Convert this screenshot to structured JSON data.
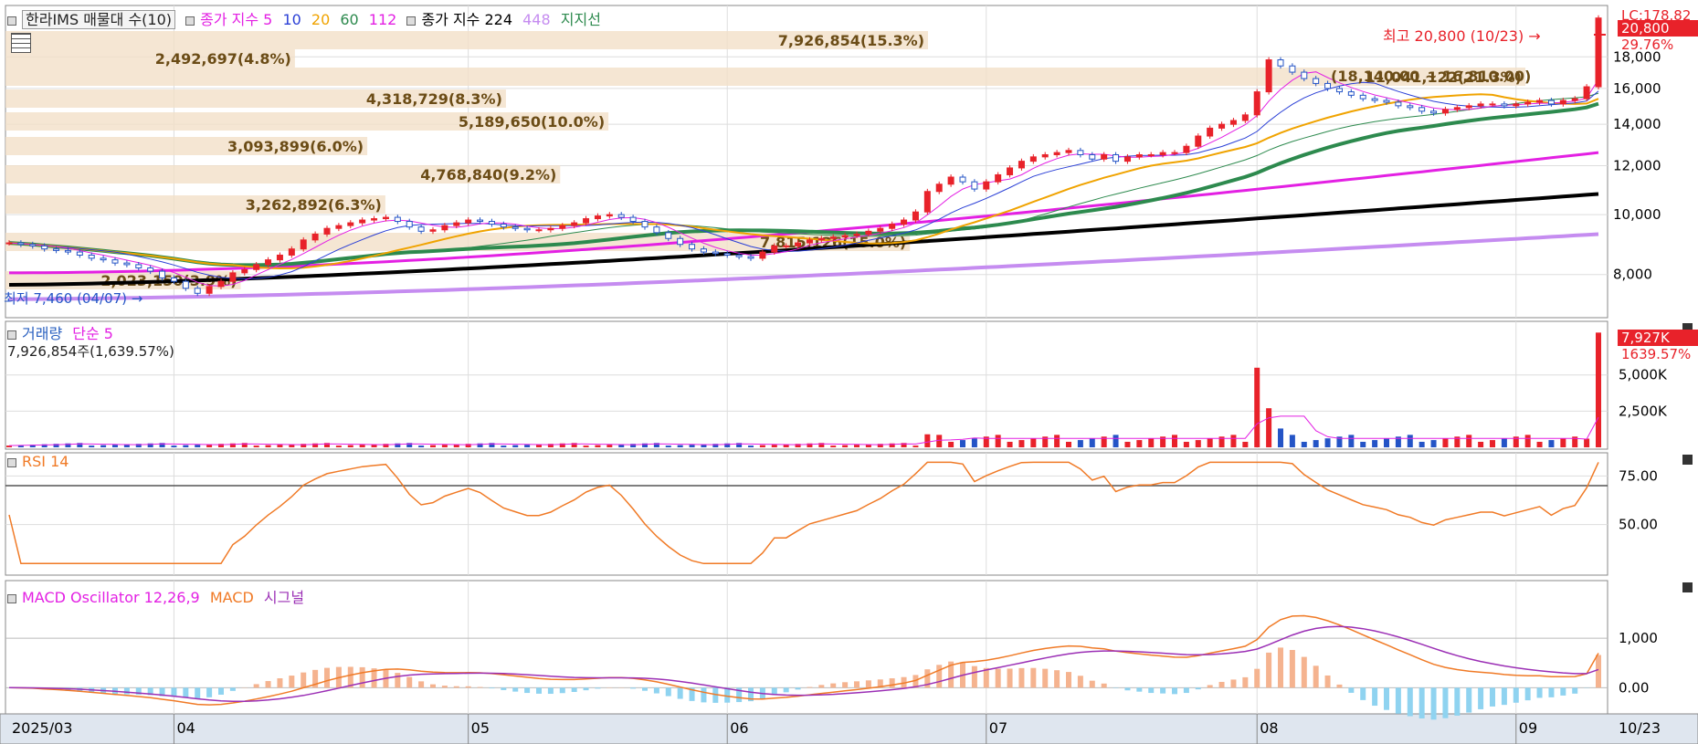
{
  "price_legend": {
    "title": "한라IMS 매물대 수(10)",
    "ma_label": "종가 지수 5",
    "ma10": "10",
    "ma20": "20",
    "ma60": "60",
    "ma112": "112",
    "ma224_label": "종가 지수 224",
    "ma448": "448",
    "support": "지지선"
  },
  "volume_legend": {
    "title": "거래량",
    "ma": "단순 5",
    "readout": "7,926,854주(1,639.57%)"
  },
  "rsi_legend": {
    "title": "RSI 14"
  },
  "macd_legend": {
    "title": "MACD Oscillator 12,26,9",
    "macd": "MACD",
    "signal": "시그널"
  },
  "annotations": {
    "high": "최고 20,800 (10/23) →",
    "low": "최저 7,460 (04/07) →",
    "lc": "LC:178.82",
    "price_tag": "20,800",
    "pct_tag": "29.76%",
    "vol_tag": "7,927K",
    "vol_pct": "1639.57%"
  },
  "colors": {
    "up": "#e8222a",
    "down": "#2454c6",
    "ma5": "#e320e3",
    "ma10": "#2a3fd6",
    "ma20": "#f0a300",
    "ma60": "#2d8a4e",
    "ma112": "#e320e3",
    "ma224": "#000000",
    "ma448": "#c58cf0",
    "rsi": "#f07a26",
    "macd": "#f07a26",
    "signal": "#9b2fb5"
  },
  "chart_data": [
    {
      "type": "candlestick",
      "title": "한라IMS 매물대 수(10)",
      "y_ticks": [
        8000,
        10000,
        12000,
        14000,
        16000,
        18000
      ],
      "x_ticks": [
        "2025/03",
        "04",
        "05",
        "06",
        "07",
        "08",
        "09",
        "10",
        "10/23"
      ],
      "last_close": 20800,
      "high": {
        "value": 20800,
        "date": "10/23"
      },
      "low": {
        "value": 7460,
        "date": "04/07"
      },
      "closes": [
        9000,
        8950,
        8900,
        8800,
        8750,
        8700,
        8600,
        8500,
        8450,
        8350,
        8300,
        8200,
        8100,
        7900,
        7800,
        7600,
        7460,
        7650,
        7800,
        8050,
        8150,
        8300,
        8450,
        8600,
        8800,
        9100,
        9300,
        9500,
        9600,
        9700,
        9800,
        9850,
        9900,
        9750,
        9550,
        9400,
        9450,
        9600,
        9700,
        9800,
        9750,
        9650,
        9550,
        9500,
        9450,
        9450,
        9500,
        9600,
        9700,
        9850,
        9950,
        10000,
        9900,
        9750,
        9550,
        9350,
        9150,
        8950,
        8800,
        8700,
        8650,
        8600,
        8550,
        8500,
        8700,
        8900,
        8900,
        9000,
        9100,
        9150,
        9200,
        9250,
        9300,
        9400,
        9500,
        9650,
        9800,
        10100,
        10900,
        11200,
        11500,
        11300,
        11000,
        11300,
        11600,
        11900,
        12200,
        12400,
        12500,
        12600,
        12700,
        12500,
        12300,
        12500,
        12200,
        12400,
        12500,
        12500,
        12600,
        12600,
        12900,
        13400,
        13800,
        14000,
        14200,
        14500,
        15800,
        17800,
        17400,
        17000,
        16600,
        16300,
        16000,
        15800,
        15600,
        15400,
        15300,
        15200,
        15000,
        14900,
        14700,
        14600,
        14800,
        14900,
        15000,
        15100,
        15100,
        15000,
        15100,
        15200,
        15300,
        15100,
        15300,
        15400,
        16100,
        20800
      ],
      "volume_series_note": "거래량"
    },
    {
      "type": "bar",
      "title": "거래량",
      "y_ticks": [
        "2,500K",
        "5,000K"
      ],
      "peak_values": [
        {
          "label": "09 spike",
          "value": 5500000
        },
        {
          "label": "10/23",
          "value": 7926854
        }
      ]
    },
    {
      "type": "line",
      "title": "RSI 14",
      "y_ticks": [
        "50.00",
        "75.00"
      ],
      "reference_line": 70
    },
    {
      "type": "line",
      "title": "MACD Oscillator 12,26,9",
      "y_ticks": [
        "0.00",
        "1,000"
      ]
    }
  ],
  "volume_profile": [
    {
      "label": "7,926,854(15.3%)",
      "pct": 15.3
    },
    {
      "label": "2,492,697(4.8%)",
      "pct": 4.8
    },
    {
      "label": "11,041,122(21.3%)",
      "pct": 21.3
    },
    {
      "label": "4,318,729(8.3%)",
      "pct": 8.3
    },
    {
      "label": "5,189,650(10.0%)",
      "pct": 10.0
    },
    {
      "label": "3,093,899(6.0%)",
      "pct": 6.0
    },
    {
      "label": "4,768,840(9.2%)",
      "pct": 9.2
    },
    {
      "label": "3,262,892(6.3%)",
      "pct": 6.3
    },
    {
      "label": "7,815,126(15.0%)",
      "pct": 15.0
    },
    {
      "label": "2,023,150(3.9%)",
      "pct": 3.9
    }
  ],
  "range_label": "(18,140.00 ~ 16,810.00)"
}
